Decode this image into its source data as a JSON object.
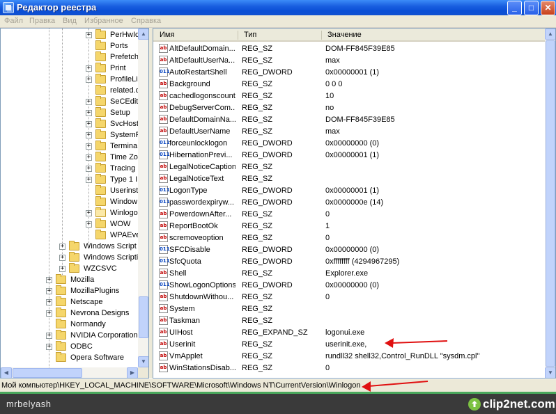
{
  "window": {
    "title": "Редактор реестра",
    "controls": {
      "minimize": "_",
      "maximize": "□",
      "close": "✕"
    }
  },
  "menu": [
    "Файл",
    "Правка",
    "Вид",
    "Избранное",
    "Справка"
  ],
  "tree": {
    "items": [
      {
        "label": "PerHwId",
        "expander": "+"
      },
      {
        "label": "Ports",
        "expander": ""
      },
      {
        "label": "Prefetch",
        "expander": ""
      },
      {
        "label": "Print",
        "expander": "+"
      },
      {
        "label": "ProfileLis",
        "expander": "+"
      },
      {
        "label": "related.d",
        "expander": ""
      },
      {
        "label": "SeCEdit",
        "expander": "+"
      },
      {
        "label": "Setup",
        "expander": "+"
      },
      {
        "label": "SvcHost",
        "expander": "+"
      },
      {
        "label": "SystemR",
        "expander": "+"
      },
      {
        "label": "Termina",
        "expander": "+"
      },
      {
        "label": "Time Zon",
        "expander": "+"
      },
      {
        "label": "Tracing",
        "expander": "+"
      },
      {
        "label": "Type 1 I",
        "expander": "+"
      },
      {
        "label": "Userinst",
        "expander": ""
      },
      {
        "label": "Window",
        "expander": ""
      },
      {
        "label": "Winlogo",
        "expander": "+",
        "open": true
      },
      {
        "label": "WOW",
        "expander": "+"
      },
      {
        "label": "WPAEve",
        "expander": ""
      },
      {
        "label": "Windows Script",
        "expander": "+"
      },
      {
        "label": "Windows Scripting",
        "expander": "+"
      },
      {
        "label": "WZCSVC",
        "expander": "+"
      },
      {
        "label": "Mozilla",
        "expander": "+"
      },
      {
        "label": "MozillaPlugins",
        "expander": "+"
      },
      {
        "label": "Netscape",
        "expander": "+"
      },
      {
        "label": "Nevrona Designs",
        "expander": "+"
      },
      {
        "label": "Normandy",
        "expander": ""
      },
      {
        "label": "NVIDIA Corporation",
        "expander": "+"
      },
      {
        "label": "ODBC",
        "expander": "+"
      },
      {
        "label": "Opera Software",
        "expander": ""
      }
    ]
  },
  "table": {
    "headers": {
      "name": "Имя",
      "type": "Тип",
      "value": "Значение"
    },
    "rows": [
      {
        "name": "AltDefaultDomain...",
        "type": "REG_SZ",
        "value": "DOM-FF845F39E85"
      },
      {
        "name": "AltDefaultUserNa...",
        "type": "REG_SZ",
        "value": "max"
      },
      {
        "name": "AutoRestartShell",
        "type": "REG_DWORD",
        "value": "0x00000001 (1)"
      },
      {
        "name": "Background",
        "type": "REG_SZ",
        "value": "0 0 0"
      },
      {
        "name": "cachedlogonscount",
        "type": "REG_SZ",
        "value": "10"
      },
      {
        "name": "DebugServerCom...",
        "type": "REG_SZ",
        "value": "no"
      },
      {
        "name": "DefaultDomainNa...",
        "type": "REG_SZ",
        "value": "DOM-FF845F39E85"
      },
      {
        "name": "DefaultUserName",
        "type": "REG_SZ",
        "value": "max"
      },
      {
        "name": "forceunlocklogon",
        "type": "REG_DWORD",
        "value": "0x00000000 (0)"
      },
      {
        "name": "HibernationPrevi...",
        "type": "REG_DWORD",
        "value": "0x00000001 (1)"
      },
      {
        "name": "LegalNoticeCaption",
        "type": "REG_SZ",
        "value": ""
      },
      {
        "name": "LegalNoticeText",
        "type": "REG_SZ",
        "value": ""
      },
      {
        "name": "LogonType",
        "type": "REG_DWORD",
        "value": "0x00000001 (1)"
      },
      {
        "name": "passwordexpiryw...",
        "type": "REG_DWORD",
        "value": "0x0000000e (14)"
      },
      {
        "name": "PowerdownAfter...",
        "type": "REG_SZ",
        "value": "0"
      },
      {
        "name": "ReportBootOk",
        "type": "REG_SZ",
        "value": "1"
      },
      {
        "name": "scremoveoption",
        "type": "REG_SZ",
        "value": "0"
      },
      {
        "name": "SFCDisable",
        "type": "REG_DWORD",
        "value": "0x00000000 (0)"
      },
      {
        "name": "SfcQuota",
        "type": "REG_DWORD",
        "value": "0xffffffff (4294967295)"
      },
      {
        "name": "Shell",
        "type": "REG_SZ",
        "value": "Explorer.exe"
      },
      {
        "name": "ShowLogonOptions",
        "type": "REG_DWORD",
        "value": "0x00000000 (0)"
      },
      {
        "name": "ShutdownWithou...",
        "type": "REG_SZ",
        "value": "0"
      },
      {
        "name": "System",
        "type": "REG_SZ",
        "value": ""
      },
      {
        "name": "Taskman",
        "type": "REG_SZ",
        "value": ""
      },
      {
        "name": "UIHost",
        "type": "REG_EXPAND_SZ",
        "value": "logonui.exe"
      },
      {
        "name": "Userinit",
        "type": "REG_SZ",
        "value": "userinit.exe,"
      },
      {
        "name": "VmApplet",
        "type": "REG_SZ",
        "value": "rundll32 shell32,Control_RunDLL \"sysdm.cpl\""
      },
      {
        "name": "WinStationsDisab...",
        "type": "REG_SZ",
        "value": "0"
      }
    ]
  },
  "status": {
    "path": "Мой компьютер\\HKEY_LOCAL_MACHINE\\SOFTWARE\\Microsoft\\Windows NT\\CurrentVersion\\Winlogon"
  },
  "footer": {
    "user": "mrbelyash",
    "brand": "clip2net.com"
  },
  "icons": {
    "sz": "ab",
    "dword": "011"
  },
  "colors": {
    "annotation_arrow": "#e01010",
    "titlebar": "#0a4fd6",
    "footer_bg": "#3a3a3a"
  }
}
